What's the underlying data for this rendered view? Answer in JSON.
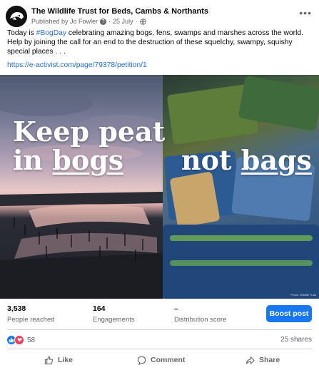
{
  "post": {
    "page_name": "The Wildlife Trust for Beds, Cambs & Northants",
    "published_by": "Published by Jo Fowler",
    "date": "25 July",
    "text_before": "Today is ",
    "hashtag": "#BogDay",
    "text_after": " celebrating amazing bogs, fens, swamps and marshes across the world. Help by joining the call for an end to the destruction of these squelchy, swampy, squishy special places . . .",
    "link": "https://e-activist.com/page/79378/petition/1"
  },
  "image": {
    "left_line1": "Keep peat",
    "left_line2_a": "in ",
    "left_line2_b": "bogs",
    "right_a": "not ",
    "right_b": "bags",
    "credit": "Photo: Wildlife Trust"
  },
  "stats": {
    "people_reached": "3,538",
    "people_reached_label": "People reached",
    "engagements": "164",
    "engagements_label": "Engagements",
    "distribution": "–",
    "distribution_label": "Distribution score",
    "boost_label": "Boost post"
  },
  "reactions": {
    "count": "58",
    "shares": "25 shares"
  },
  "actions": {
    "like": "Like",
    "comment": "Comment",
    "share": "Share"
  },
  "colors": {
    "accent": "#1877f2",
    "link": "#216fdb",
    "like": "#1877f2",
    "love": "#f33e58"
  }
}
